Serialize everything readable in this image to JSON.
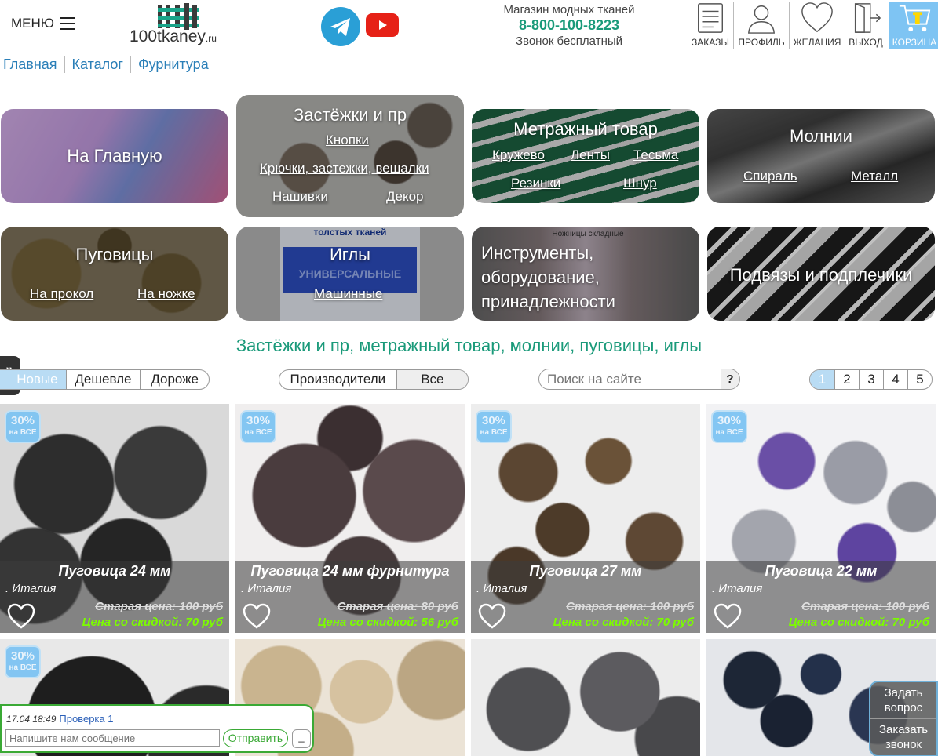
{
  "header": {
    "menu_label": "МЕНЮ",
    "logo_text": "100tkaney",
    "logo_domain": ".ru",
    "shop_tagline": "Магазин модных тканей",
    "phone": "8-800-100-8223",
    "call_note": "Звонок бесплатный",
    "user_icons": [
      {
        "label": "ЗАКАЗЫ",
        "icon": "orders-icon"
      },
      {
        "label": "ПРОФИЛЬ",
        "icon": "profile-icon"
      },
      {
        "label": "ЖЕЛАНИЯ",
        "icon": "heart-icon"
      },
      {
        "label": "ВЫХОД",
        "icon": "exit-icon"
      },
      {
        "label": "КОРЗИНА",
        "icon": "cart-icon"
      }
    ]
  },
  "breadcrumbs": [
    "Главная",
    "Каталог",
    "Фурнитура"
  ],
  "categories": {
    "home": {
      "title": "На Главную"
    },
    "fasteners": {
      "title": "Застёжки и пр",
      "links": [
        "Кнопки",
        "Крючки, застежки, вешалки",
        "Нашивки",
        "Декор"
      ]
    },
    "yardage": {
      "title": "Метражный товар",
      "links": [
        "Кружево",
        "Ленты",
        "Тесьма",
        "Резинки",
        "Шнур"
      ]
    },
    "zippers": {
      "title": "Молнии",
      "links": [
        "Спираль",
        "Металл"
      ]
    },
    "buttons": {
      "title": "Пуговицы",
      "links": [
        "На прокол",
        "На ножке"
      ]
    },
    "needles": {
      "title": "Иглы",
      "links": [
        "Машинные"
      ],
      "package_text_top": "толстых тканей",
      "package_text_mid": "УНИВЕРСАЛЬНЫЕ"
    },
    "tools": {
      "title": "Инструменты, оборудование, принадлежности",
      "package_text": "Ножницы складные"
    },
    "straps": {
      "title": "Подвязы и подплечики"
    }
  },
  "section_title": "Застёжки и пр, метражный товар, молнии, пуговицы, иглы",
  "controls": {
    "sort": [
      "Новые",
      "Дешевле",
      "Дороже"
    ],
    "sort_active": 0,
    "makers": [
      "Производители",
      "Все"
    ],
    "search_placeholder": "Поиск на сайте",
    "search_help": "?",
    "pages": [
      "1",
      "2",
      "3",
      "4",
      "5"
    ],
    "page_active": 0
  },
  "badge": {
    "pct": "30%",
    "sub": "на ВСЕ"
  },
  "products": [
    {
      "name": "Пуговица 24 мм",
      "country": ". Италия",
      "old_price": "Старая цена: 100 руб",
      "new_price": "Цена со скидкой: 70 руб"
    },
    {
      "name": "Пуговица 24 мм фурнитура",
      "country": ". Италия",
      "old_price": "Старая цена: 80 руб",
      "new_price": "Цена со скидкой: 56 руб"
    },
    {
      "name": "Пуговица 27 мм",
      "country": ". Италия",
      "old_price": "Старая цена: 100 руб",
      "new_price": "Цена со скидкой: 70 руб"
    },
    {
      "name": "Пуговица 22 мм",
      "country": ". Италия",
      "old_price": "Старая цена: 100 руб",
      "new_price": "Цена со скидкой: 70 руб"
    }
  ],
  "chat": {
    "time": "17.04 18:49",
    "user": "Проверка 1",
    "placeholder": "Напишите нам сообщение",
    "send": "Отправить",
    "minimize": "_"
  },
  "floating": {
    "ask": "Задать вопрос",
    "call": "Заказать звонок"
  }
}
